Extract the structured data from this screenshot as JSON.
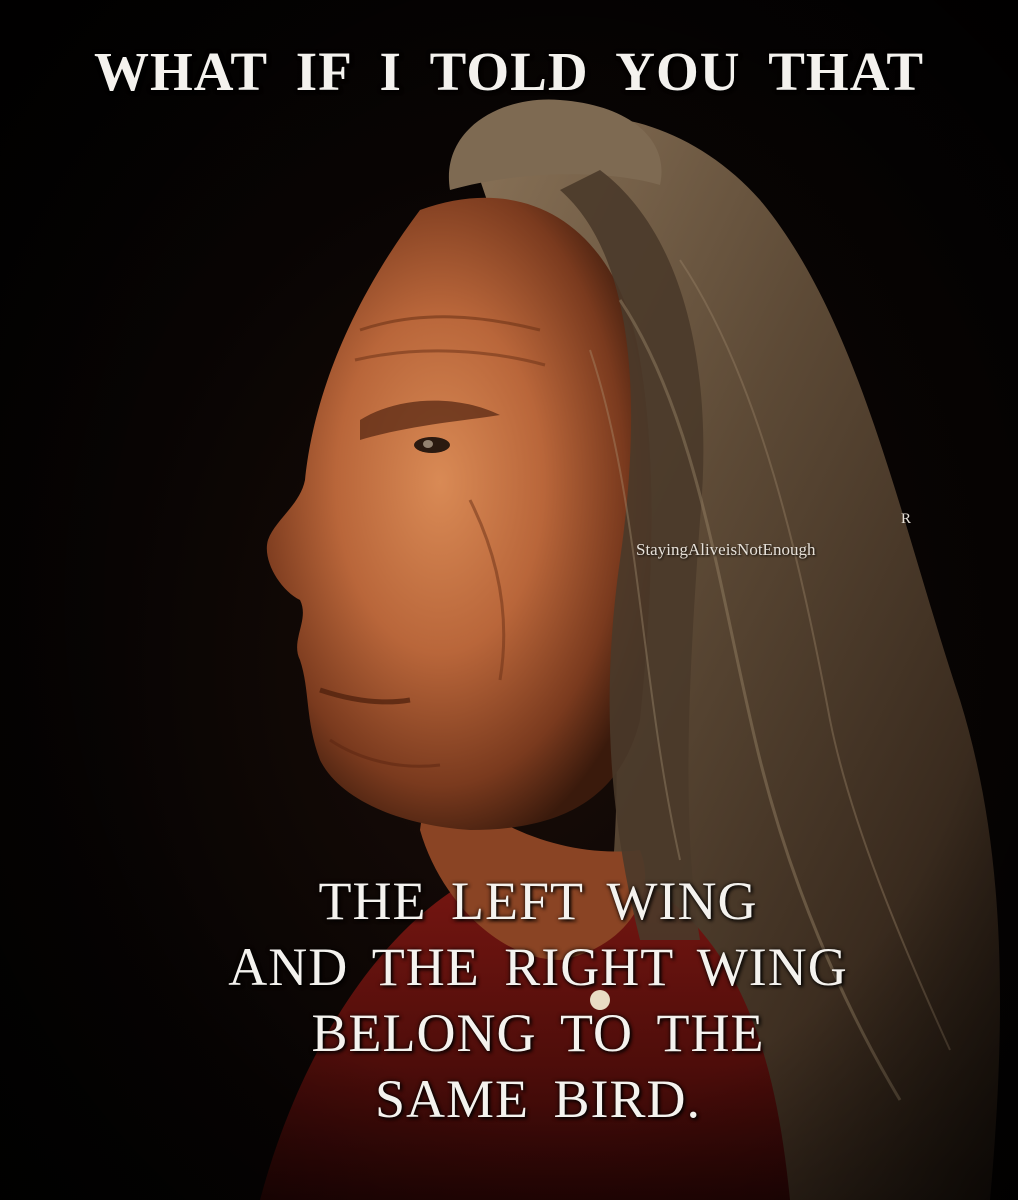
{
  "image": {
    "description": "Profile portrait of an elderly man with long hair against a dark background",
    "background_color": "#050302",
    "skin_tone": "#c06b3c",
    "hair_color": "#6b5640",
    "clothing_color": "#6e1410"
  },
  "caption": {
    "top": "WHAT IF I TOLD YOU THAT",
    "bottom_lines": [
      "THE LEFT WING",
      "AND THE RIGHT WING",
      "BELONG TO THE",
      "SAME BIRD."
    ],
    "text_color": "#f4f2ee"
  },
  "watermark": {
    "text": "StayingAliveisNotEnough",
    "mark": "R"
  }
}
